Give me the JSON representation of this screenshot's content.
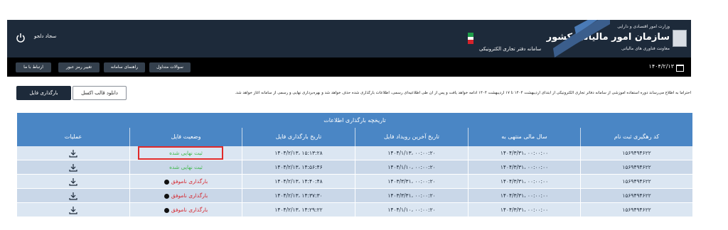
{
  "header": {
    "ministry": "وزارت امور اقتصادی و دارایی",
    "organization": "سازمان امور مالیاتی کشور",
    "deputy": "معاونت فناوری های مالیاتی",
    "subsystem": "سامانه دفتر تجاری الکترونیکی",
    "user_name": "سجاد دلجو"
  },
  "navbar": {
    "items": [
      "ارتباط با ما",
      "تغییر رمز عبور",
      "راهنمای سامانه",
      "سوالات متداول"
    ],
    "date": "۱۴۰۴/۲/۱۳"
  },
  "toolbar": {
    "upload_label": "بارگذاری فایل",
    "excel_label": "دانلود قالب اکسل",
    "notice": "احتراما به اطلاع می‌رساند دوره استفاده آموزشی از سامانه دفاتر تجاری الکترونیکی از ابتدای اردیبهشت ۱۴۰۴ تا ۱۷ اردیبهشت ۱۴۰۴ ادامه خواهد یافت و پس از آن طی اطلاعیه‌ای رسمی، اطلاعات بارگذاری شده حذف خواهد شد و بهره‌برداری نهایی و رسمی از سامانه آغاز خواهد شد."
  },
  "table": {
    "title": "تاریخچه بارگذاری اطلاعات",
    "headers": [
      "عملیات",
      "وضعیت فایل",
      "تاریخ بارگذاری فایل",
      "تاریخ آخرین رویداد فایل",
      "سال مالی منتهی به",
      "کد رهگیری ثبت نام"
    ],
    "rows": [
      {
        "status": "ثبت نهایی شده",
        "status_type": "ok",
        "upload_date": "۱۴۰۴/۲/۱۳، ۱۵:۱۳:۲۸",
        "last_event": "۱۴۰۴/۱/۱۳، ۰۰:۰۰:۲۰",
        "fiscal_year": "۱۴۰۴/۳/۳۱، ۰۰:۰۰:۰۰",
        "tracking_code": "۱۵۶۹۴۹۴۶۲۲"
      },
      {
        "status": "ثبت نهایی شده",
        "status_type": "ok",
        "upload_date": "۱۴۰۴/۲/۱۳، ۱۴:۵۶:۴۶",
        "last_event": "۱۴۰۴/۱/۱۰، ۰۰:۰۰:۲۰",
        "fiscal_year": "۱۴۰۴/۳/۳۱، ۰۰:۰۰:۰۰",
        "tracking_code": "۱۵۶۹۴۹۴۶۲۲"
      },
      {
        "status": "بارگذاری ناموفق",
        "status_type": "fail",
        "upload_date": "۱۴۰۴/۲/۱۳، ۱۴:۴۰:۴۸",
        "last_event": "۱۴۰۳/۳/۳۱، ۰۰:۰۰:۲۰",
        "fiscal_year": "۱۴۰۴/۳/۳۱، ۰۰:۰۰:۰۰",
        "tracking_code": "۱۵۶۹۴۹۴۶۲۲"
      },
      {
        "status": "بارگذاری ناموفق",
        "status_type": "fail",
        "upload_date": "۱۴۰۴/۲/۱۳، ۱۴:۳۷:۳۰",
        "last_event": "۱۴۰۳/۳/۳۱، ۰۰:۰۰:۲۰",
        "fiscal_year": "۱۴۰۴/۳/۳۱، ۰۰:۰۰:۰۰",
        "tracking_code": "۱۵۶۹۴۹۴۶۲۲"
      },
      {
        "status": "بارگذاری ناموفق",
        "status_type": "fail",
        "upload_date": "۱۴۰۴/۲/۱۳، ۱۴:۲۹:۲۲",
        "last_event": "۱۴۰۴/۱/۱۰، ۰۰:۰۰:۲۰",
        "fiscal_year": "۱۴۰۴/۳/۳۱، ۰۰:۰۰:۰۰",
        "tracking_code": "۱۵۶۹۴۹۴۶۲۲"
      }
    ]
  },
  "colors": {
    "header_bg": "#1d2a3a",
    "nav_bg": "#000000",
    "table_header": "#4a86c5",
    "row_a": "#dbe6f2",
    "row_b": "#c9d7e8",
    "status_ok": "#3fb84a",
    "status_fail": "#d6232b"
  }
}
